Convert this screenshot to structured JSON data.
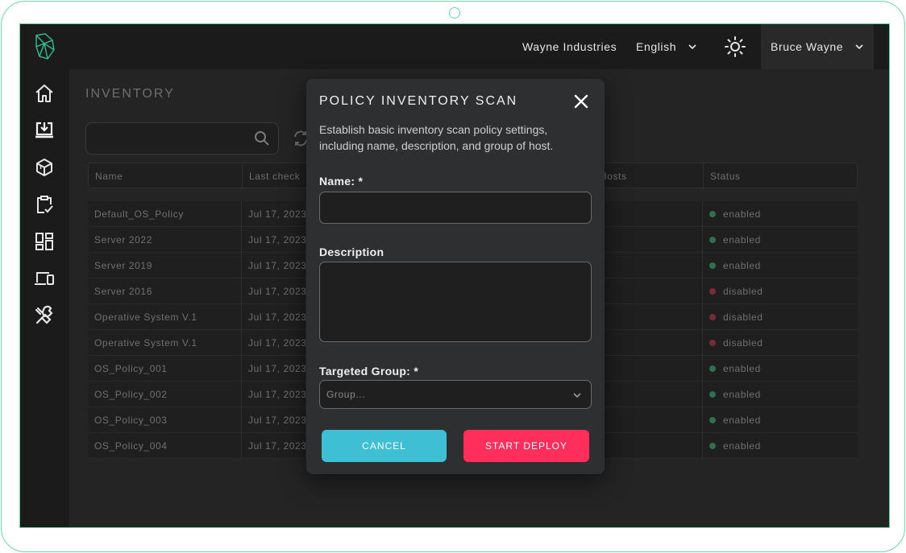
{
  "header": {
    "company": "Wayne Industries",
    "language": "English",
    "user": "Bruce Wayne"
  },
  "sidebar": {
    "items": [
      {
        "name": "home-icon"
      },
      {
        "name": "inventory-download-icon"
      },
      {
        "name": "cube-icon"
      },
      {
        "name": "clipboard-check-icon"
      },
      {
        "name": "dashboard-grid-icon"
      },
      {
        "name": "devices-icon"
      },
      {
        "name": "tools-icon"
      }
    ]
  },
  "inventory": {
    "title": "INVENTORY",
    "columns": [
      "Name",
      "Last check",
      "Hosts",
      "Status"
    ],
    "rows": [
      {
        "name": "Default_OS_Policy",
        "last_check": "Jul 17, 2023",
        "status": "enabled"
      },
      {
        "name": "Server 2022",
        "last_check": "Jul 17, 2023",
        "status": "enabled"
      },
      {
        "name": "Server 2019",
        "last_check": "Jul 17, 2023",
        "status": "enabled"
      },
      {
        "name": "Server 2016",
        "last_check": "Jul 17, 2023",
        "status": "disabled"
      },
      {
        "name": "Operative System V.1",
        "last_check": "Jul 17, 2023",
        "status": "disabled"
      },
      {
        "name": "Operative System V.1",
        "last_check": "Jul 17, 2023",
        "status": "disabled"
      },
      {
        "name": "OS_Policy_001",
        "last_check": "Jul 17, 2023",
        "status": "enabled"
      },
      {
        "name": "OS_Policy_002",
        "last_check": "Jul 17, 2023",
        "status": "enabled"
      },
      {
        "name": "OS_Policy_003",
        "last_check": "Jul 17, 2023",
        "status": "enabled"
      },
      {
        "name": "OS_Policy_004",
        "last_check": "Jul 17, 2023",
        "status": "enabled"
      }
    ]
  },
  "modal": {
    "title": "POLICY INVENTORY SCAN",
    "description": "Establish basic inventory scan policy settings, including name, description, and group of host.",
    "name_label": "Name: *",
    "name_value": "",
    "description_label": "Description",
    "description_value": "",
    "group_label": "Targeted Group: *",
    "group_placeholder": "Group...",
    "cancel_label": "CANCEL",
    "deploy_label": "START DEPLOY"
  },
  "colors": {
    "accent_cancel": "#3ebfd3",
    "accent_deploy": "#ff2e5a",
    "status_enabled": "#2f6e4e",
    "status_disabled": "#7a2a3a",
    "logo": "#2fbf8f"
  }
}
